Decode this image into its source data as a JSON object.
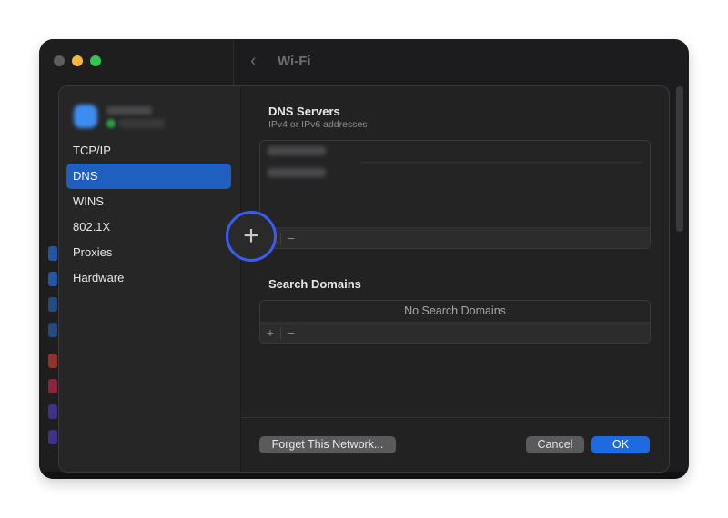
{
  "window": {
    "title": "Wi-Fi",
    "traffic_lights": [
      "close",
      "minimize",
      "maximize"
    ],
    "back_icon": "chevron-left-icon"
  },
  "sheet": {
    "profile": {
      "name": "[blurred]",
      "status": "connected"
    },
    "nav": [
      {
        "label": "TCP/IP",
        "active": false
      },
      {
        "label": "DNS",
        "active": true
      },
      {
        "label": "WINS",
        "active": false
      },
      {
        "label": "802.1X",
        "active": false
      },
      {
        "label": "Proxies",
        "active": false
      },
      {
        "label": "Hardware",
        "active": false
      }
    ],
    "dns": {
      "title": "DNS Servers",
      "subtitle": "IPv4 or IPv6 addresses",
      "entries": [
        "[blurred]",
        "[blurred]"
      ],
      "add_label": "+",
      "remove_label": "−"
    },
    "search_domains": {
      "title": "Search Domains",
      "empty_text": "No Search Domains",
      "add_label": "+",
      "remove_label": "−"
    },
    "buttons": {
      "forget": "Forget This Network...",
      "cancel": "Cancel",
      "ok": "OK"
    }
  },
  "annotation": {
    "highlight": "add-dns-server-button"
  },
  "colors": {
    "accent": "#1f5fbf",
    "ok_button": "#1e6ae0",
    "highlight_ring": "#3b5cf0"
  }
}
